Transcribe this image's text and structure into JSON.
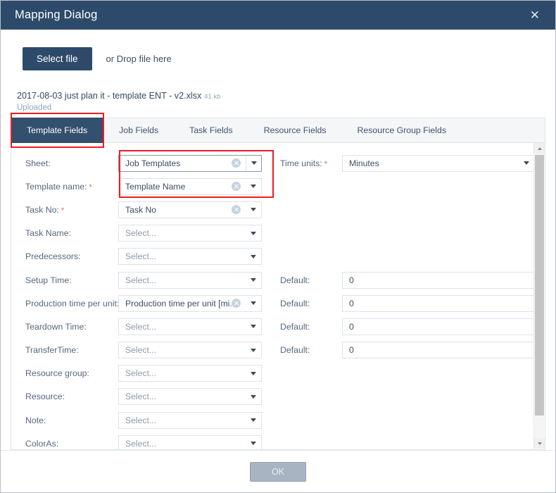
{
  "dialog": {
    "title": "Mapping Dialog",
    "close_icon": "close-icon"
  },
  "upload": {
    "select_file_label": "Select file",
    "drop_hint": "or Drop file here",
    "file_name": "2017-08-03 just plan it - template ENT - v2.xlsx",
    "file_size": "41 kb",
    "status": "Uploaded"
  },
  "tabs": [
    {
      "label": "Template Fields",
      "active": true
    },
    {
      "label": "Job Fields",
      "active": false
    },
    {
      "label": "Task Fields",
      "active": false
    },
    {
      "label": "Resource Fields",
      "active": false
    },
    {
      "label": "Resource Group Fields",
      "active": false
    }
  ],
  "form": {
    "placeholder": "Select...",
    "rows": [
      {
        "label": "Sheet:",
        "required": false,
        "value": "Job Templates",
        "clearable": true,
        "split": true,
        "focused": true
      },
      {
        "label": "Template name:",
        "required": true,
        "value": "Template Name",
        "clearable": true,
        "split": false,
        "focused": false
      },
      {
        "label": "Task No:",
        "required": true,
        "value": "Task No",
        "clearable": true,
        "split": false,
        "focused": false
      },
      {
        "label": "Task Name:",
        "required": false,
        "value": "Select...",
        "clearable": false,
        "split": false,
        "focused": false
      },
      {
        "label": "Predecessors:",
        "required": false,
        "value": "Select...",
        "clearable": false,
        "split": false,
        "focused": false
      },
      {
        "label": "Setup Time:",
        "required": false,
        "value": "Select...",
        "clearable": false,
        "split": false,
        "focused": false
      },
      {
        "label": "Production time per unit:",
        "required": true,
        "value": "Production time per unit [mi...",
        "clearable": true,
        "split": false,
        "focused": false
      },
      {
        "label": "Teardown Time:",
        "required": false,
        "value": "Select...",
        "clearable": false,
        "split": false,
        "focused": false
      },
      {
        "label": "TransferTime:",
        "required": false,
        "value": "Select...",
        "clearable": false,
        "split": false,
        "focused": false
      },
      {
        "label": "Resource group:",
        "required": false,
        "value": "Select...",
        "clearable": false,
        "split": false,
        "focused": false
      },
      {
        "label": "Resource:",
        "required": false,
        "value": "Select...",
        "clearable": false,
        "split": false,
        "focused": false
      },
      {
        "label": "Note:",
        "required": false,
        "value": "Select...",
        "clearable": false,
        "split": false,
        "focused": false
      },
      {
        "label": "ColorAs:",
        "required": false,
        "value": "Select...",
        "clearable": false,
        "split": false,
        "focused": false
      }
    ],
    "time_units": {
      "label": "Time units:",
      "required": true,
      "value": "Minutes"
    },
    "defaults": [
      {
        "label": "Default:",
        "value": "0"
      },
      {
        "label": "Default:",
        "value": "0"
      },
      {
        "label": "Default:",
        "value": "0"
      },
      {
        "label": "Default:",
        "value": "0"
      }
    ]
  },
  "footer": {
    "ok_label": "OK",
    "ok_enabled": false
  },
  "colors": {
    "header_bg": "#2e4a6b",
    "accent": "#33506f",
    "annotation": "#ef1b24",
    "required_marker": "#e8605f",
    "disabled_button": "#a8b4c2"
  },
  "scrollbar": {
    "up_icon": "chevron-up-icon",
    "down_icon": "chevron-down-icon"
  }
}
